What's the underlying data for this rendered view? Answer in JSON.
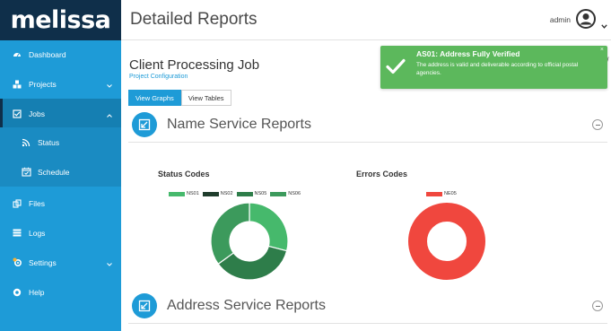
{
  "brand": {
    "logo_text": "melissa"
  },
  "sidebar": {
    "items": [
      {
        "label": "Dashboard",
        "icon": "dashboard-icon"
      },
      {
        "label": "Projects",
        "icon": "cubes-icon"
      },
      {
        "label": "Jobs",
        "icon": "check-square-icon"
      },
      {
        "label": "Status",
        "icon": "rss-icon"
      },
      {
        "label": "Schedule",
        "icon": "calendar-check-icon"
      },
      {
        "label": "Files",
        "icon": "copy-icon"
      },
      {
        "label": "Logs",
        "icon": "list-icon"
      },
      {
        "label": "Settings",
        "icon": "cogs-icon"
      },
      {
        "label": "Help",
        "icon": "help-circle-icon"
      }
    ]
  },
  "header": {
    "title": "Detailed Reports",
    "user": "admin"
  },
  "job": {
    "title": "Client Processing Job",
    "subtitle": "Project Configuration",
    "view_graphs": "View Graphs",
    "view_tables": "View Tables"
  },
  "sections": {
    "name_service": "Name Service Reports",
    "address_service": "Address Service Reports"
  },
  "toast": {
    "title": "AS01: Address Fully Verified",
    "message": "The address is valid and deliverable according to official postal agencies.",
    "close": "×",
    "color": "#5cb85c"
  },
  "edge_text": "/",
  "colors": {
    "accent": "#1e9bd7",
    "sidebar_dark": "#0f2f4a",
    "success": "#5cb85c"
  },
  "chart_data": [
    {
      "type": "pie",
      "title": "Status Codes",
      "categories": [
        "NS01",
        "NS02",
        "NS05",
        "NS06"
      ],
      "values": [
        29,
        0,
        36,
        35
      ],
      "colors": [
        "#46b96c",
        "#1f3d2c",
        "#2e7d4a",
        "#3c9a5c"
      ],
      "legend": "top"
    },
    {
      "type": "pie",
      "title": "Errors Codes",
      "categories": [
        "NE05"
      ],
      "values": [
        100
      ],
      "colors": [
        "#f0473e"
      ],
      "legend": "top"
    }
  ]
}
